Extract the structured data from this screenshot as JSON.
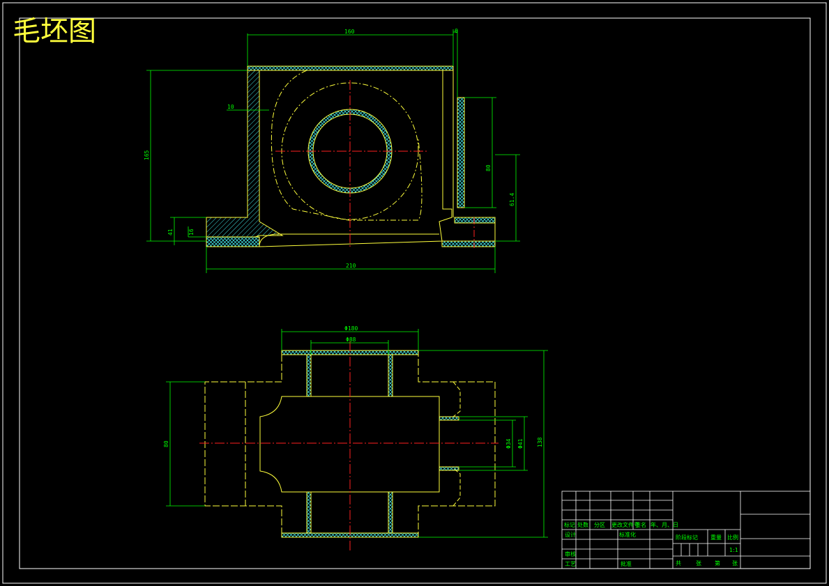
{
  "drawing": {
    "title": "毛坯图",
    "colors": {
      "background": "#000000",
      "outline": "#ffff3c",
      "centerline": "#ff2020",
      "dimension": "#00ff00",
      "hatch": "#40e0e0",
      "border": "#ffffff"
    }
  },
  "front_view": {
    "dims": {
      "top_width": "160",
      "top_right": "6",
      "left_height": "165",
      "left_small_a": "41",
      "left_small_b": "16",
      "inner_wall": "10",
      "right_height": "80",
      "right_dim2": "61.4",
      "bottom_width": "210"
    }
  },
  "top_view": {
    "dims": {
      "outer_dia": "Φ180",
      "inner_dia": "Φ88",
      "left_height": "80",
      "bore_a": "Φ34",
      "bore_b": "Φ41",
      "right_height": "138"
    }
  },
  "title_block": {
    "row_labels": [
      "标记",
      "处数",
      "分区",
      "更改文件号",
      "签名",
      "年、月、日"
    ],
    "design": "设计",
    "standardize": "标准化",
    "review": "审核",
    "process": "工艺",
    "approve": "批准",
    "stage_mark": "阶段标记",
    "weight": "重量",
    "scale": "比例",
    "scale_value": "1:1",
    "sheets_total": "共",
    "sheets_unit1": "张",
    "sheet_no": "第",
    "sheets_unit2": "张"
  }
}
